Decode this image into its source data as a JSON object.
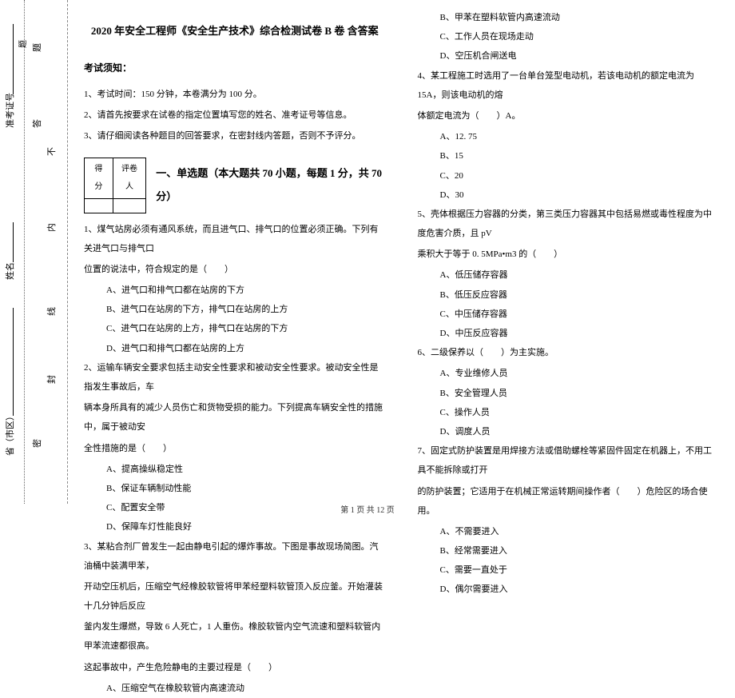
{
  "binding": {
    "province": "省（市区）",
    "name": "姓名",
    "ticket": "准考证号",
    "seal": "密",
    "feng": "封",
    "xian": "线",
    "nei": "内",
    "bu": "不",
    "da": "答",
    "ti": "题",
    "top_char": "题",
    "bottom_char": "密"
  },
  "header": {
    "title": "2020 年安全工程师《安全生产技术》综合检测试卷 B 卷 含答案",
    "notice_head": "考试须知：",
    "notice1": "1、考试时间：150 分钟，本卷满分为 100 分。",
    "notice2": "2、请首先按要求在试卷的指定位置填写您的姓名、准考证号等信息。",
    "notice3": "3、请仔细阅读各种题目的回答要求，在密封线内答题，否则不予评分。"
  },
  "scorebox": {
    "c1": "得分",
    "c2": "评卷人"
  },
  "section1": {
    "title": "一、单选题（本大题共 70 小题，每题 1 分，共 70 分）"
  },
  "q1": {
    "stem1": "1、煤气站房必须有通风系统，而且进气口、排气口的位置必须正确。下列有关进气口与排气口",
    "stem2": "位置的说法中，符合规定的是（　　）",
    "a": "A、进气口和排气口都在站房的下方",
    "b": "B、进气口在站房的下方，排气口在站房的上方",
    "c": "C、进气口在站房的上方，排气口在站房的下方",
    "d": "D、进气口和排气口都在站房的上方"
  },
  "q2": {
    "stem1": "2、运输车辆安全要求包括主动安全性要求和被动安全性要求。被动安全性是指发生事故后，车",
    "stem2": "辆本身所具有的减少人员伤亡和货物受损的能力。下列提高车辆安全性的措施中，属于被动安",
    "stem3": "全性措施的是（　　）",
    "a": "A、提高操纵稳定性",
    "b": "B、保证车辆制动性能",
    "c": "C、配置安全带",
    "d": "D、保障车灯性能良好"
  },
  "q3": {
    "stem1": "3、某粘合剂厂曾发生一起由静电引起的爆炸事故。下图是事故现场简图。汽油桶中装满甲苯，",
    "stem2": "开动空压机后，压缩空气经橡胶软管将甲苯经塑料软管顶入反应釜。开始灌装十几分钟后反应",
    "stem3": "釜内发生爆燃，导致 6 人死亡，1 人重伤。橡胶软管内空气流速和塑料软管内甲苯流速都很高。",
    "stem4": "这起事故中，产生危险静电的主要过程是（　　）",
    "a": "A、压缩空气在橡胶软管内高速流动"
  },
  "q3r": {
    "b": "B、甲苯在塑料软管内高速流动",
    "c": "C、工作人员在现场走动",
    "d": "D、空压机合闸送电"
  },
  "q4": {
    "stem1": "4、某工程施工时选用了一台单台笼型电动机，若该电动机的额定电流为 15A，则该电动机的熔",
    "stem2": "体额定电流为（　　）A。",
    "a": "A、12. 75",
    "b": "B、15",
    "c": "C、20",
    "d": "D、30"
  },
  "q5": {
    "stem1": "5、壳体根据压力容器的分类，第三类压力容器其中包括易燃或毒性程度为中度危害介质，且 pV",
    "stem2": "乘积大于等于 0. 5MPa•m3 的（　　）",
    "a": "A、低压储存容器",
    "b": "B、低压反应容器",
    "c": "C、中压储存容器",
    "d": "D、中压反应容器"
  },
  "q6": {
    "stem": "6、二级保养以（　　）为主实施。",
    "a": "A、专业维修人员",
    "b": "B、安全管理人员",
    "c": "C、操作人员",
    "d": "D、调度人员"
  },
  "q7": {
    "stem1": "7、固定式防护装置是用焊接方法或借助螺栓等紧固件固定在机器上，不用工具不能拆除或打开",
    "stem2": "的防护装置；它适用于在机械正常运转期间操作者（　　）危险区的场合使用。",
    "a": "A、不需要进入",
    "b": "B、经常需要进入",
    "c": "C、需要一直处于",
    "d": "D、偶尔需要进入"
  },
  "footer": "第 1 页 共 12 页"
}
